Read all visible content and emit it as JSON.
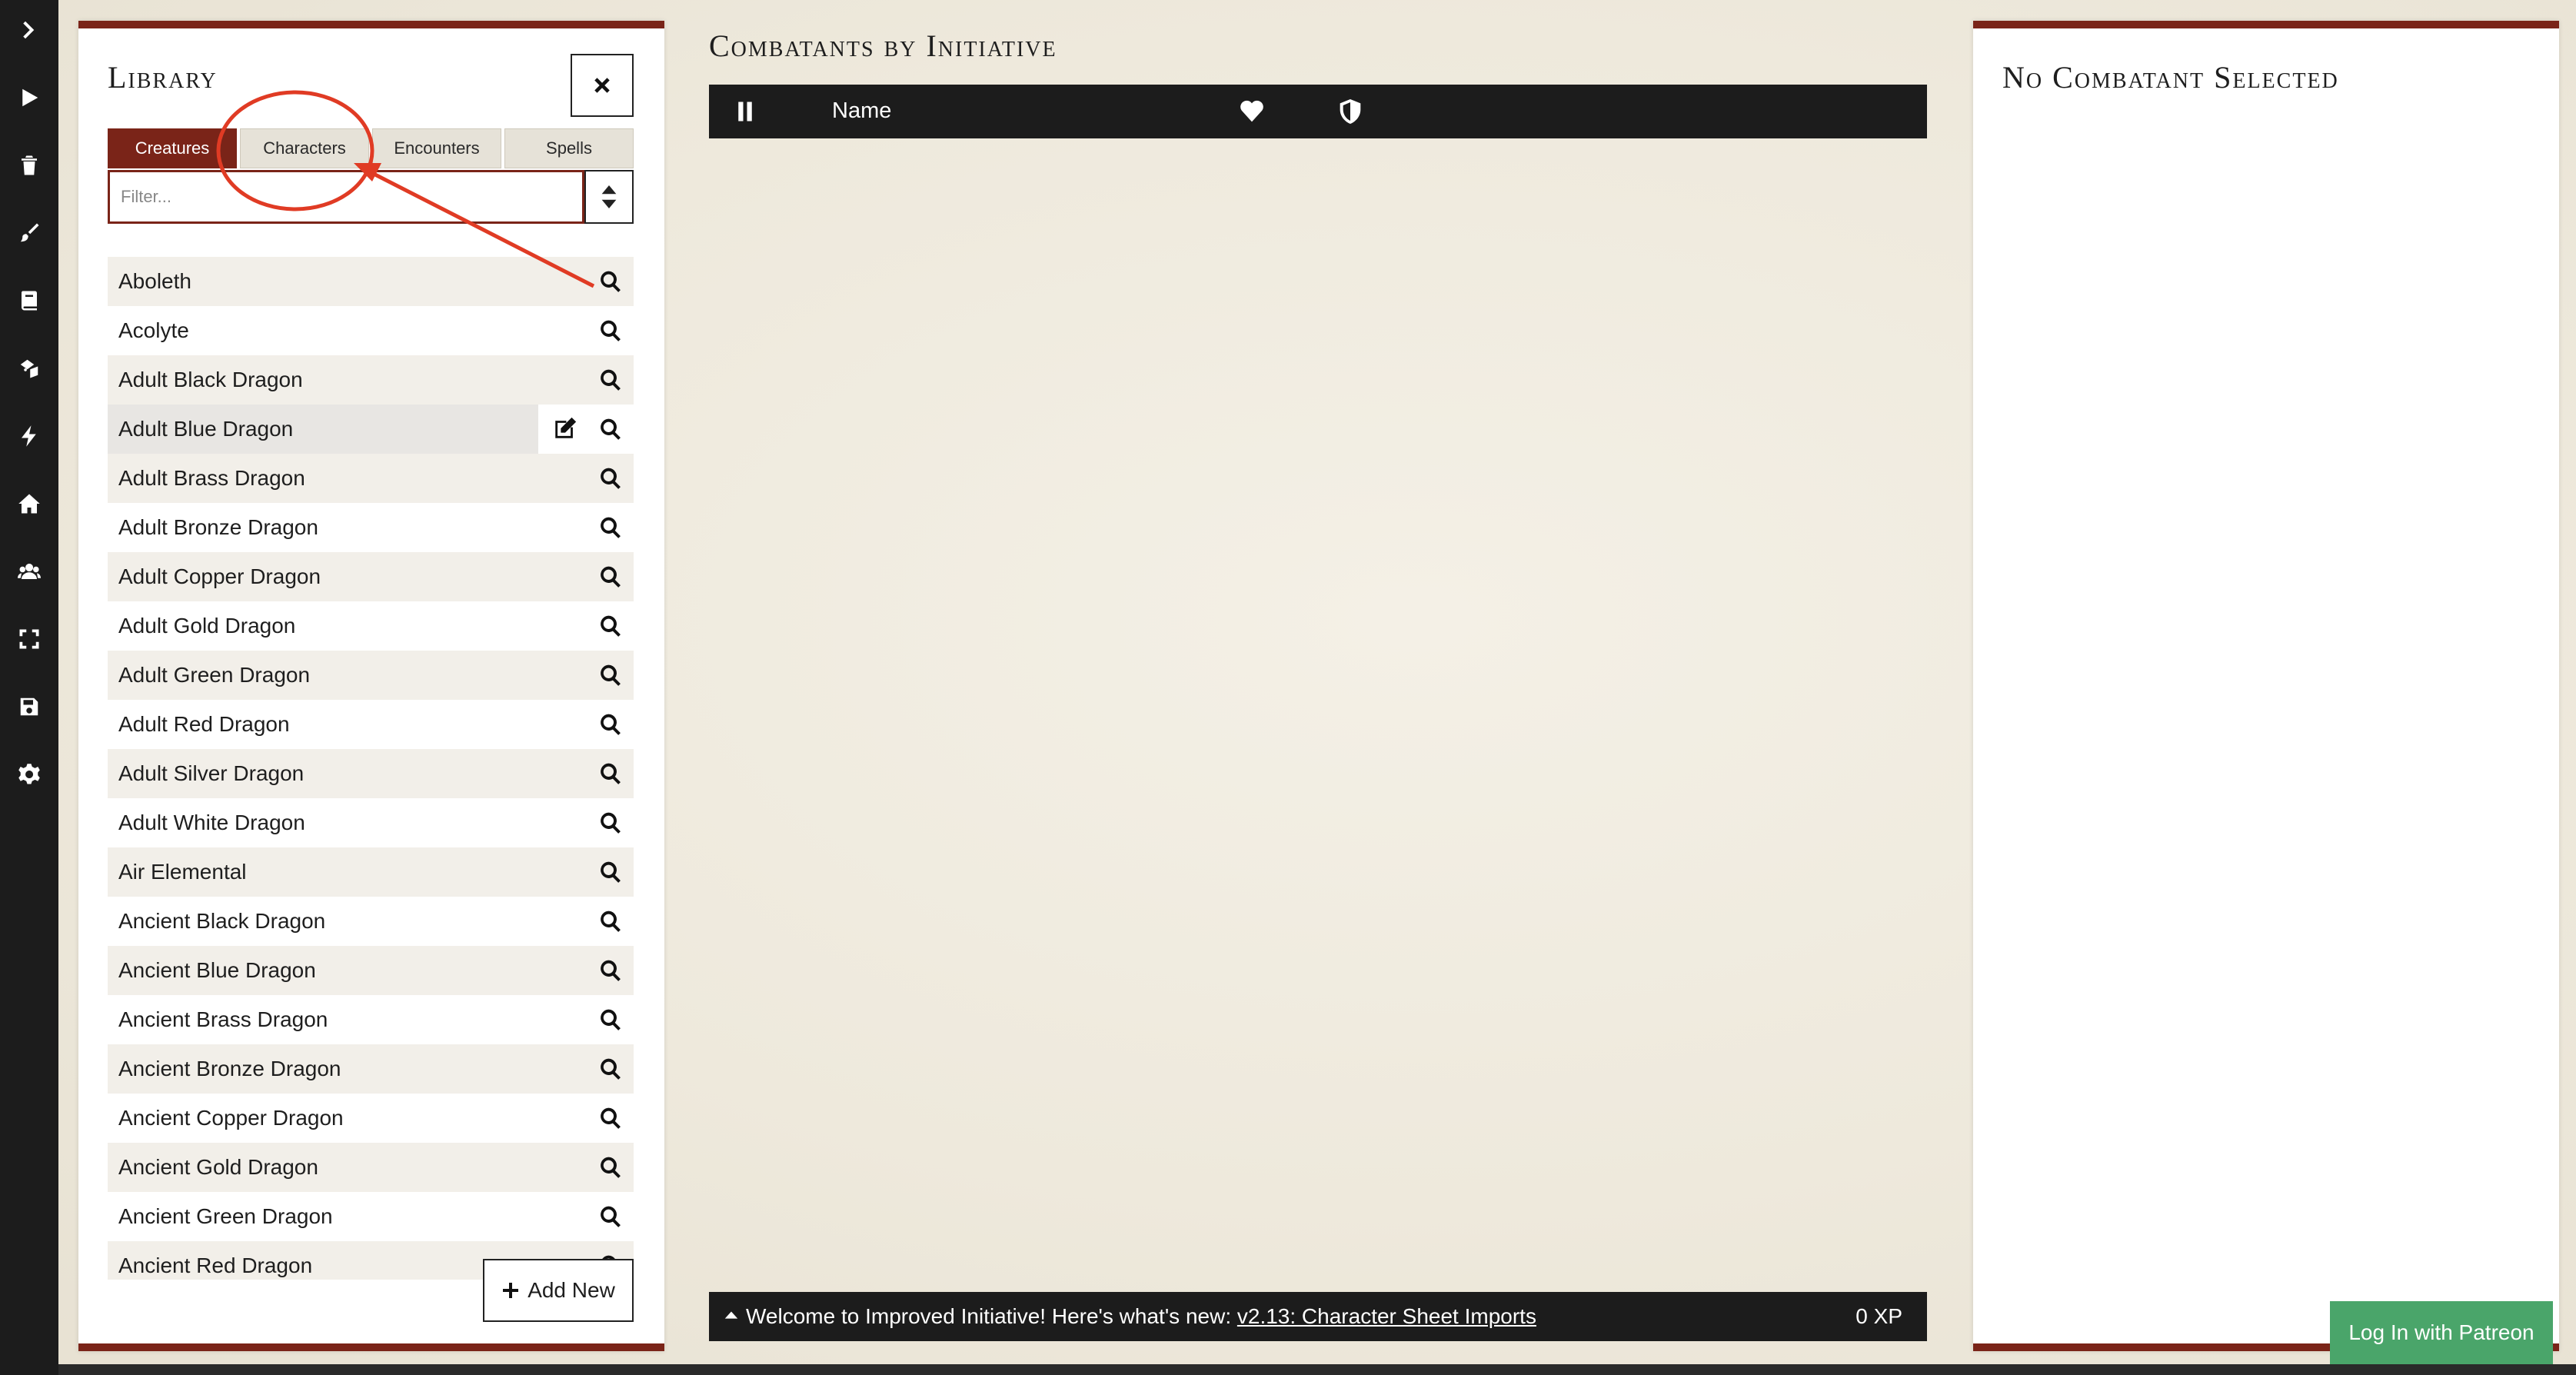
{
  "rail": {
    "icons": [
      "chevron-right-icon",
      "play-icon",
      "trash-icon",
      "brush-icon",
      "book-icon",
      "dice-icon",
      "bolt-icon",
      "home-icon",
      "users-icon",
      "fullscreen-icon",
      "save-icon",
      "gear-icon"
    ]
  },
  "library": {
    "title": "Library",
    "tabs": [
      {
        "label": "Creatures",
        "active": true
      },
      {
        "label": "Characters",
        "active": false
      },
      {
        "label": "Encounters",
        "active": false
      },
      {
        "label": "Spells",
        "active": false
      }
    ],
    "filter_placeholder": "Filter...",
    "items": [
      "Aboleth",
      "Acolyte",
      "Adult Black Dragon",
      "Adult Blue Dragon",
      "Adult Brass Dragon",
      "Adult Bronze Dragon",
      "Adult Copper Dragon",
      "Adult Gold Dragon",
      "Adult Green Dragon",
      "Adult Red Dragon",
      "Adult Silver Dragon",
      "Adult White Dragon",
      "Air Elemental",
      "Ancient Black Dragon",
      "Ancient Blue Dragon",
      "Ancient Brass Dragon",
      "Ancient Bronze Dragon",
      "Ancient Copper Dragon",
      "Ancient Gold Dragon",
      "Ancient Green Dragon",
      "Ancient Red Dragon"
    ],
    "hovered_item": "Adult Blue Dragon",
    "add_new_label": "Add New"
  },
  "center": {
    "title": "Combatants by Initiative",
    "header": {
      "name_label": "Name"
    },
    "footer": {
      "message": "Welcome to Improved Initiative! Here's what's new: ",
      "link": "v2.13: Character Sheet Imports",
      "xp": "0 XP"
    }
  },
  "details": {
    "title": "No Combatant Selected"
  },
  "patreon_label": "Log In with Patreon",
  "colors": {
    "accent": "#7a2418",
    "annotation": "#e03b24",
    "patreon": "#4aa56a",
    "dark": "#1c1c1c"
  }
}
